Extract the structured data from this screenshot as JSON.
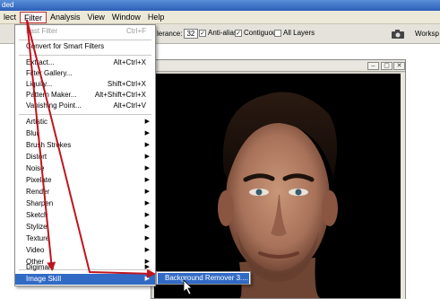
{
  "window": {
    "title_fragment": "ded"
  },
  "menubar": {
    "items": [
      {
        "label": "lect"
      },
      {
        "label": "Filter"
      },
      {
        "label": "Analysis"
      },
      {
        "label": "View"
      },
      {
        "label": "Window"
      },
      {
        "label": "Help"
      }
    ]
  },
  "options": {
    "tolerance_label": "lerance:",
    "tolerance_value": "32",
    "anti_alias_label": "Anti-alias",
    "contiguous_label": "Contiguous",
    "all_layers_label": "All Layers",
    "workspace_label": "Worksp"
  },
  "filter_menu": {
    "last_filter": {
      "label": "Last Filter",
      "shortcut": "Ctrl+F"
    },
    "convert_smart": {
      "label": "Convert for Smart Filters"
    },
    "extract": {
      "label": "Extract...",
      "shortcut": "Alt+Ctrl+X"
    },
    "filter_gallery": {
      "label": "Filter Gallery..."
    },
    "liquify": {
      "label": "Liquify...",
      "shortcut": "Shift+Ctrl+X"
    },
    "pattern_maker": {
      "label": "Pattern Maker...",
      "shortcut": "Alt+Shift+Ctrl+X"
    },
    "vanishing_point": {
      "label": "Vanishing Point...",
      "shortcut": "Alt+Ctrl+V"
    },
    "categories": [
      "Artistic",
      "Blur",
      "Brush Strokes",
      "Distort",
      "Noise",
      "Pixelate",
      "Render",
      "Sharpen",
      "Sketch",
      "Stylize",
      "Texture",
      "Video",
      "Other"
    ],
    "plugins": [
      "Digimarc",
      "Image Skill"
    ]
  },
  "submenu": {
    "item": "Background Remover 3...."
  },
  "colors": {
    "menu_highlight": "#316ac5",
    "arrow_red": "#c0141e",
    "menubar_bg": "#ece9d8"
  }
}
